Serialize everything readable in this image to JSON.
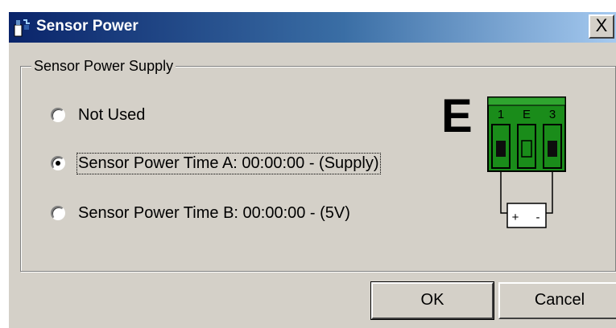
{
  "window": {
    "title": "Sensor Power",
    "close_label": "X"
  },
  "group": {
    "label": "Sensor Power Supply",
    "options": [
      {
        "label": "Not Used",
        "checked": false
      },
      {
        "label": "Sensor Power Time A: 00:00:00 - (Supply)",
        "checked": true
      },
      {
        "label": "Sensor Power Time B: 00:00:00 - (5V)",
        "checked": false
      }
    ]
  },
  "connector": {
    "letter": "E",
    "pins": [
      "1",
      "E",
      "3"
    ],
    "battery_plus": "+",
    "battery_minus": "-",
    "colors": {
      "block": "#1a8c1a",
      "pin": "#0d0d0d"
    }
  },
  "buttons": {
    "ok": "OK",
    "cancel": "Cancel"
  }
}
